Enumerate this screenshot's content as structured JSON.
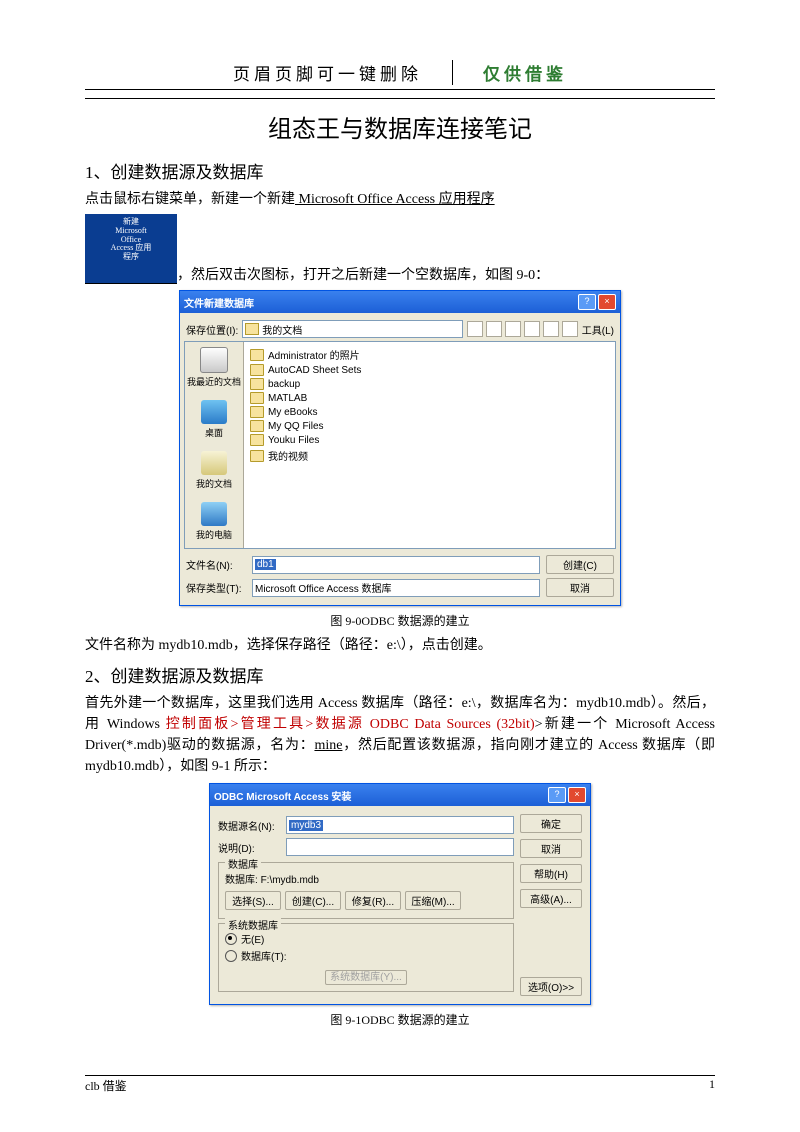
{
  "header": {
    "left": "页眉页脚可一键删除",
    "right": "仅供借鉴"
  },
  "title": "组态王与数据库连接笔记",
  "sec1": {
    "heading": "1、创建数据源及数据库",
    "p1a": " 点击鼠标右键菜单，新建一个新建",
    "p1u": "    Microsoft    Office    Access    应用程序",
    "iconLabel1": "新建",
    "iconLabel2": "Microsoft",
    "iconLabel3": "Office",
    "iconLabel4": "Access 应用",
    "iconLabel5": "程序",
    "p_after_icon": "，然后双击次图标，打开之后新建一个空数据库，如图 9-0：",
    "dlg1": {
      "title": "文件新建数据库",
      "saveLocLabel": "保存位置(I):",
      "saveLoc": "我的文档",
      "toolsLabel": "工具(L)",
      "places": {
        "recent": "我最近的文档",
        "desktop": "桌面",
        "docs": "我的文档",
        "computer": "我的电脑"
      },
      "files": [
        "Administrator 的照片",
        "AutoCAD Sheet Sets",
        "backup",
        "MATLAB",
        "My eBooks",
        "My QQ Files",
        "Youku Files",
        "我的视频"
      ],
      "fileNameLabel": "文件名(N):",
      "fileName": "db1",
      "saveTypeLabel": "保存类型(T):",
      "saveType": "Microsoft Office Access 数据库",
      "createBtn": "创建(C)",
      "cancelBtn": "取消"
    },
    "caption1": "图 9-0ODBC 数据源的建立",
    "p3": "文件名称为 mydb10.mdb，选择保存路径（路径：e:\\），点击创建。"
  },
  "sec2": {
    "heading": "2、创建数据源及数据库",
    "p1": "首先外建一个数据库，这里我们选用 Access 数据库（路径：e:\\，数据库名为：mydb10.mdb）。然后，用 Windows ",
    "p1_red": "控制面板>管理工具>数据源 ODBC Data Sources (32bit)",
    "p1_tail": ">新建一个 Microsoft Access Driver(*.mdb)驱动的数据源，名为：",
    "p1_mine": "mine",
    "p1_end": "，然后配置该数据源，指向刚才建立的 Access 数据库（即 mydb10.mdb），如图 9-1 所示：",
    "dlg2": {
      "title": "ODBC Microsoft Access 安装",
      "dsnLabel": "数据源名(N):",
      "dsn": "mydb3",
      "descLabel": "说明(D):",
      "grpDb": "数据库",
      "dbLabel": "数据库:",
      "dbPath": "F:\\mydb.mdb",
      "btnSelect": "选择(S)...",
      "btnCreate": "创建(C)...",
      "btnRepair": "修复(R)...",
      "btnCompress": "压缩(M)...",
      "grpSys": "系统数据库",
      "radioNone": "无(E)",
      "radioDb": "数据库(T):",
      "btnSysDb": "系统数据库(Y)...",
      "btnOk": "确定",
      "btnCancel": "取消",
      "btnHelp": "帮助(H)",
      "btnAdv": "高级(A)...",
      "btnOpt": "选项(O)>>"
    },
    "caption2": "图 9-1ODBC 数据源的建立"
  },
  "footer": {
    "left": "clb 借鉴",
    "page": "1"
  }
}
